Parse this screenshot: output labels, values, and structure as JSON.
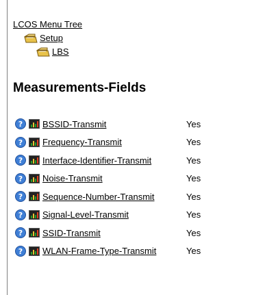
{
  "breadcrumb": {
    "root": "LCOS Menu Tree",
    "level1": "Setup",
    "level2": "LBS"
  },
  "page": {
    "title": "Measurements-Fields"
  },
  "icons": {
    "folder": "folder-icon",
    "help": "help-icon",
    "chart": "chart-icon"
  },
  "colors": {
    "help_blue": "#3f7fd6",
    "chart_green": "#22a02a",
    "folder_yellow": "#e8c24a"
  },
  "fields": [
    {
      "label": "BSSID-Transmit",
      "value": "Yes"
    },
    {
      "label": "Frequency-Transmit",
      "value": "Yes"
    },
    {
      "label": "Interface-Identifier-Transmit",
      "value": "Yes"
    },
    {
      "label": "Noise-Transmit",
      "value": "Yes"
    },
    {
      "label": "Sequence-Number-Transmit",
      "value": "Yes"
    },
    {
      "label": "Signal-Level-Transmit",
      "value": "Yes"
    },
    {
      "label": "SSID-Transmit",
      "value": "Yes"
    },
    {
      "label": "WLAN-Frame-Type-Transmit",
      "value": "Yes"
    }
  ]
}
